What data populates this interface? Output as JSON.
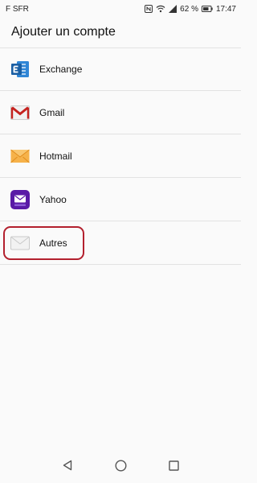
{
  "status_bar": {
    "carrier": "F SFR",
    "battery": "62 %",
    "time": "17:47"
  },
  "page": {
    "title": "Ajouter un compte"
  },
  "accounts": [
    {
      "label": "Exchange",
      "icon": "exchange-icon"
    },
    {
      "label": "Gmail",
      "icon": "gmail-icon"
    },
    {
      "label": "Hotmail",
      "icon": "hotmail-icon"
    },
    {
      "label": "Yahoo",
      "icon": "yahoo-icon"
    },
    {
      "label": "Autres",
      "icon": "mail-icon"
    }
  ],
  "colors": {
    "highlight": "#b3202e",
    "exchange": "#1e6fb8",
    "gmail": "#c5221f",
    "hotmail": "#f2a23a",
    "yahoo": "#5a1aa6"
  }
}
